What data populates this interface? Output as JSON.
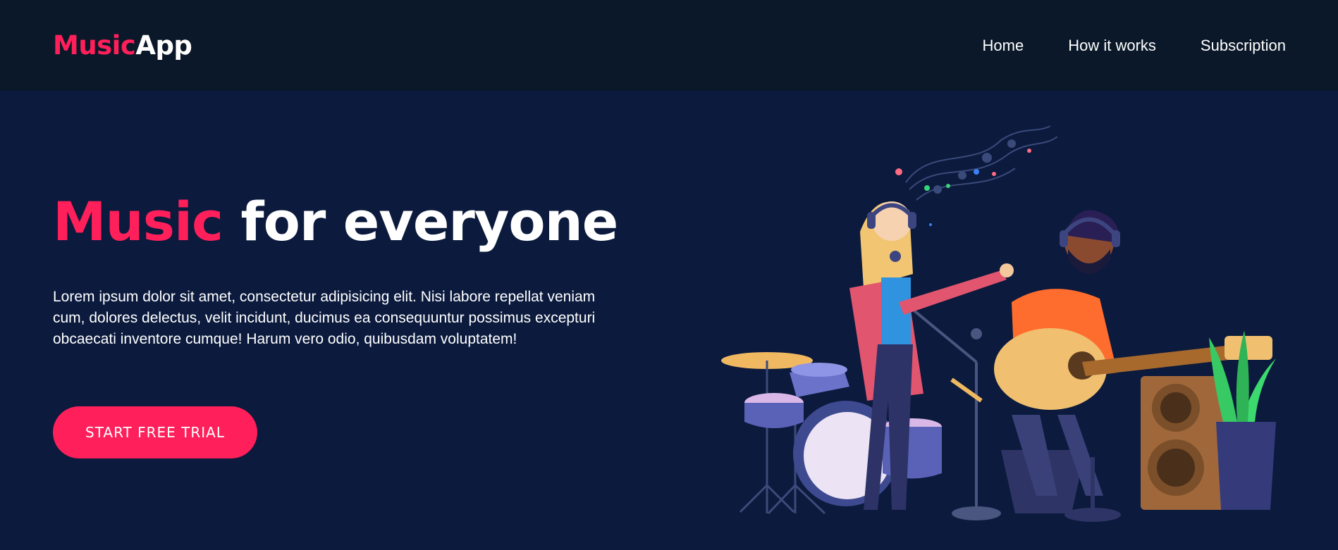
{
  "app": {
    "logo_accent": "Music",
    "logo_rest": "App"
  },
  "nav": {
    "items": [
      {
        "label": "Home"
      },
      {
        "label": "How it works"
      },
      {
        "label": "Subscription"
      }
    ]
  },
  "hero": {
    "title_accent": "Music",
    "title_rest": " for everyone",
    "description": "Lorem ipsum dolor sit amet, consectetur adipisicing elit. Nisi labore repellat veniam cum, dolores delectus, velit incidunt, ducimus ea consequuntur possimus excepturi obcaecati inventore cumque! Harum vero odio, quibusdam voluptatem!",
    "cta_label": "START FREE TRIAL"
  },
  "colors": {
    "accent": "#ff1f5a",
    "navbar_bg": "#0a1829",
    "hero_bg": "#0b1a3d"
  },
  "illustration": {
    "icon": "band-illustration"
  }
}
